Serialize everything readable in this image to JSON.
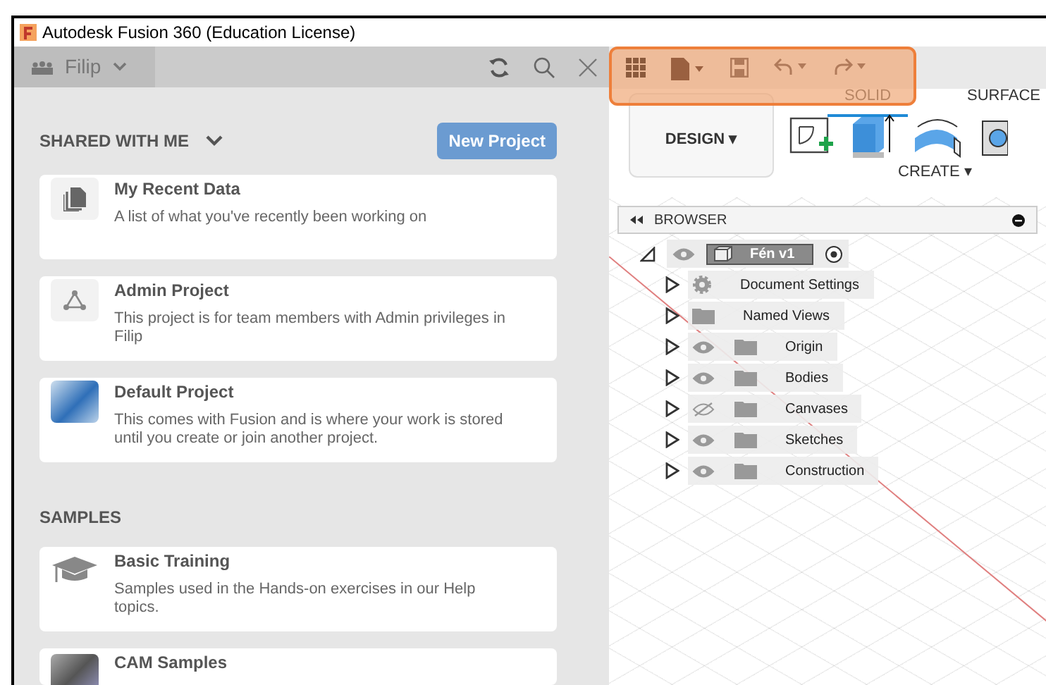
{
  "window": {
    "title": "Autodesk Fusion 360 (Education License)"
  },
  "data_panel": {
    "team": "Filip",
    "section": "SHARED WITH ME",
    "new_project": "New Project",
    "projects": [
      {
        "kind": "recent",
        "title": "My Recent Data",
        "description": "A list of what you've recently been working on"
      },
      {
        "kind": "admin",
        "title": "Admin Project",
        "description": "This project is for team members with Admin privileges in Filip"
      },
      {
        "kind": "default",
        "title": "Default Project",
        "description": "This comes with Fusion and is where your work is stored until you create or join another project."
      }
    ],
    "samples_heading": "SAMPLES",
    "samples": [
      {
        "kind": "training",
        "title": "Basic Training",
        "description": "Samples used in the Hands-on exercises in our Help topics."
      },
      {
        "kind": "cam",
        "title": "CAM Samples"
      }
    ]
  },
  "ribbon": {
    "workspace": "DESIGN ▾",
    "tabs": [
      {
        "label": "SOLID",
        "selected": true
      },
      {
        "label": "SURFACE",
        "selected": false
      }
    ],
    "group": "CREATE ▾"
  },
  "browser": {
    "title": "BROWSER",
    "root": {
      "label": "Fén v1",
      "expanded": true,
      "visible": true,
      "children": [
        {
          "label": "Document Settings",
          "kind": "settings",
          "expanded": false
        },
        {
          "label": "Named Views",
          "kind": "folder",
          "expanded": false
        },
        {
          "label": "Origin",
          "kind": "folder",
          "expanded": false,
          "visible": true
        },
        {
          "label": "Bodies",
          "kind": "folder",
          "expanded": false,
          "visible": true
        },
        {
          "label": "Canvases",
          "kind": "folder",
          "expanded": false,
          "visible": false
        },
        {
          "label": "Sketches",
          "kind": "folder",
          "expanded": false,
          "visible": true
        },
        {
          "label": "Construction",
          "kind": "folder",
          "expanded": false,
          "visible": true
        }
      ]
    }
  }
}
